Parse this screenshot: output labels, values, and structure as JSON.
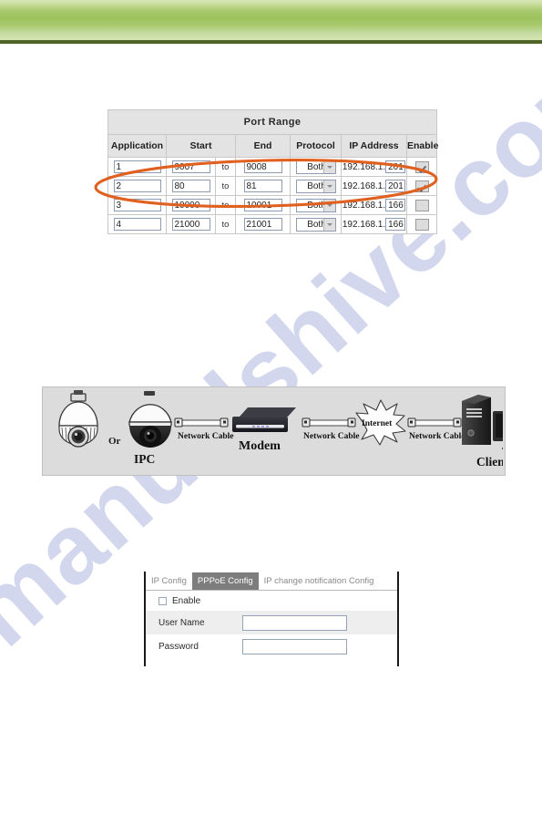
{
  "banner": {
    "color_top": "#d9e7b8",
    "color_mid": "#9cc25c",
    "rule_color": "#4f6527"
  },
  "watermark": {
    "text": "manualshive.com",
    "color": "#b9bfe4"
  },
  "port_range": {
    "title": "Port Range",
    "columns": [
      "Application",
      "Start",
      "End",
      "Protocol",
      "IP Address",
      "Enable"
    ],
    "to_label": "to",
    "ip_prefix": "192.168.1.",
    "highlight_color": "#e0601f",
    "rows": [
      {
        "application": "1",
        "start": "9007",
        "end": "9008",
        "protocol": "Both",
        "ip_suffix": "201",
        "enable": true
      },
      {
        "application": "2",
        "start": "80",
        "end": "81",
        "protocol": "Both",
        "ip_suffix": "201",
        "enable": true
      },
      {
        "application": "3",
        "start": "10000",
        "end": "10001",
        "protocol": "Both",
        "ip_suffix": "166",
        "enable": false
      },
      {
        "application": "4",
        "start": "21000",
        "end": "21001",
        "protocol": "Both",
        "ip_suffix": "166",
        "enable": false
      }
    ]
  },
  "topology": {
    "ipc_label": "IPC",
    "or_label": "Or",
    "modem_label": "Modem",
    "internet_label": "Internet",
    "client_label": "Client",
    "cable_label_1": "Network Cable",
    "cable_label_2": "Network Cable",
    "cable_label_3": "Network Cable"
  },
  "pppoe": {
    "tabs": [
      {
        "label": "IP Config",
        "active": false
      },
      {
        "label": "PPPoE Config",
        "active": true
      },
      {
        "label": "IP change notification Config",
        "active": false
      }
    ],
    "enable_label": "Enable",
    "enable_checked": false,
    "fields": [
      {
        "label": "User Name",
        "value": ""
      },
      {
        "label": "Password",
        "value": ""
      }
    ]
  }
}
